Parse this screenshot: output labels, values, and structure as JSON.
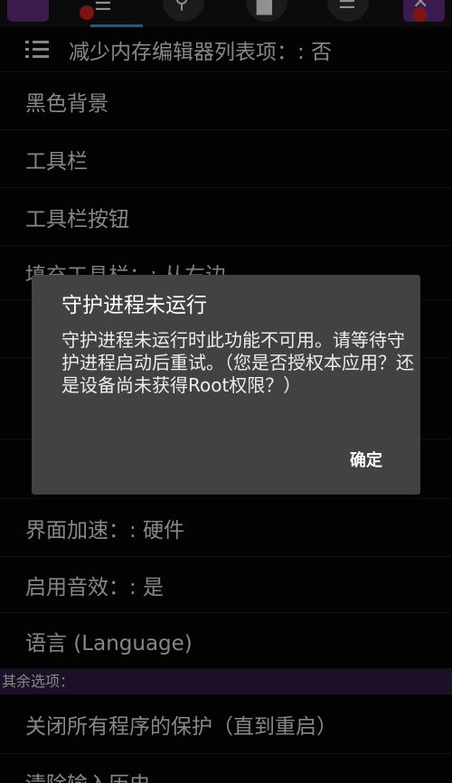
{
  "list": {
    "items": [
      {
        "label": "减少内存编辑器列表项：: 否"
      },
      {
        "label": "黑色背景"
      },
      {
        "label": "工具栏"
      },
      {
        "label": "工具栏按钮"
      },
      {
        "label": "填充工具栏：: 从右边"
      },
      {
        "label": ""
      },
      {
        "label": ""
      },
      {
        "label": ""
      },
      {
        "label": "界面加速：: 硬件"
      },
      {
        "label": "启用音效：: 是"
      },
      {
        "label": "语言 (Language)"
      }
    ],
    "section_header": "其余选项：",
    "extra_items": [
      {
        "label": "关闭所有程序的保护（直到重启）"
      },
      {
        "label": "清除输入历史"
      }
    ]
  },
  "dialog": {
    "title": "守护进程未运行",
    "message": "守护进程未运行时此功能不可用。请等待守护进程启动后重试。（您是否授权本应用？还是设备尚未获得Root权限？）",
    "ok_label": "确定"
  },
  "colors": {
    "background": "#060606",
    "dialog_bg": "#424242",
    "section_header_bg": "#2a1a3a",
    "accent_underline": "#2c8fd1"
  }
}
